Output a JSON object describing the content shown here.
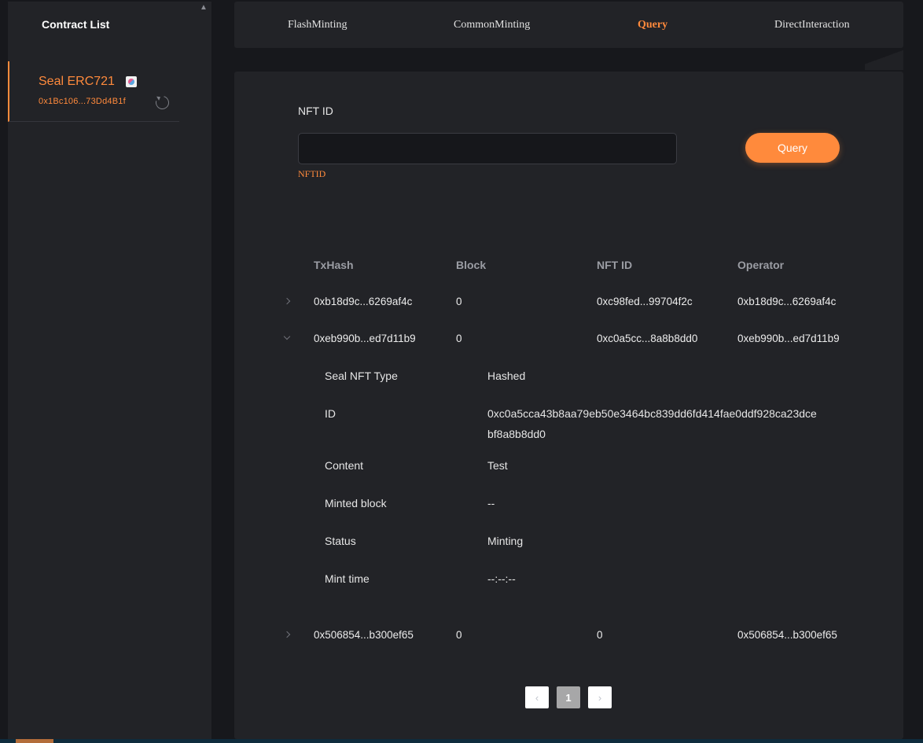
{
  "sidebar": {
    "title": "Contract List",
    "scroll_up_icon": "chevron-up-icon",
    "contracts": [
      {
        "name": "Seal ERC721",
        "address": "0x1Bc106...73Dd4B1f",
        "badge_icon": "contract-type-icon",
        "action_icon": "refresh-icon"
      }
    ]
  },
  "nav": {
    "tabs": [
      {
        "label": "FlashMinting"
      },
      {
        "label": "CommonMinting"
      },
      {
        "label": "Query"
      },
      {
        "label": "DirectInteraction"
      }
    ],
    "active": "Query"
  },
  "query": {
    "field_label": "NFT ID",
    "input_value": "",
    "input_placeholder": "",
    "validation_message": "NFTID",
    "button_label": "Query"
  },
  "table": {
    "headers": [
      "TxHash",
      "Block",
      "NFT ID",
      "Operator"
    ],
    "rows": [
      {
        "txhash": "0xb18d9c...6269af4c",
        "block": "0",
        "nft_id": "0xc98fed...99704f2c",
        "operator": "0xb18d9c...6269af4c",
        "expanded": false
      },
      {
        "txhash": "0xeb990b...ed7d11b9",
        "block": "0",
        "nft_id": "0xc0a5cc...8a8b8dd0",
        "operator": "0xeb990b...ed7d11b9",
        "expanded": true
      },
      {
        "txhash": "0x506854...b300ef65",
        "block": "0",
        "nft_id": "0",
        "operator": "0x506854...b300ef65",
        "expanded": false
      }
    ],
    "details": [
      {
        "label": "Seal NFT Type",
        "value": "Hashed"
      },
      {
        "label": "ID",
        "value": "0xc0a5cca43b8aa79eb50e3464bc839dd6fd414fae0ddf928ca23dcebf8a8b8dd0"
      },
      {
        "label": "Content",
        "value": "Test"
      },
      {
        "label": "Minted block",
        "value": "--"
      },
      {
        "label": "Status",
        "value": "Minting"
      },
      {
        "label": "Mint time",
        "value": "--:--:--"
      }
    ]
  },
  "pagination": {
    "current_page": "1",
    "prev_icon": "chevron-left-icon",
    "next_icon": "chevron-right-icon"
  },
  "colors": {
    "accent": "#ff8a3c",
    "panel": "#222327",
    "background": "#17181c"
  }
}
